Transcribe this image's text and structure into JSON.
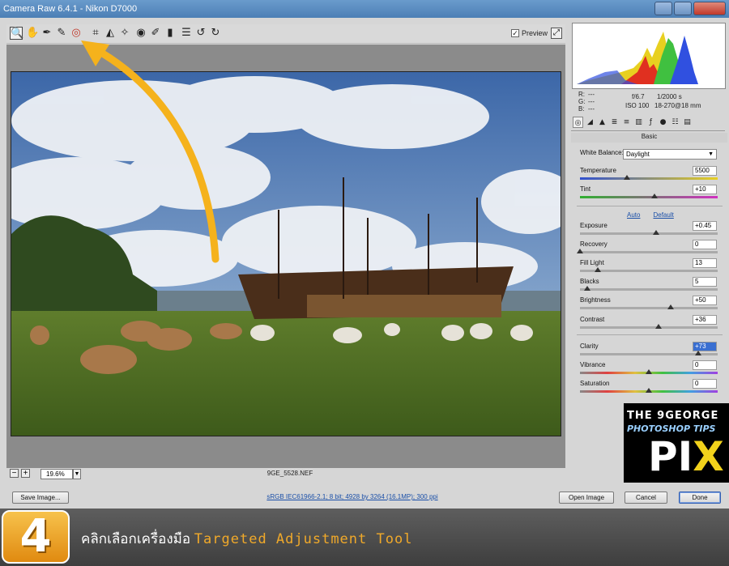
{
  "window": {
    "title": "Camera Raw 6.4.1  -  Nikon D7000"
  },
  "toolbar": {
    "tools": [
      {
        "name": "zoom-tool",
        "glyph": "🔍"
      },
      {
        "name": "hand-tool",
        "glyph": "✋"
      },
      {
        "name": "white-balance-tool",
        "glyph": "✒"
      },
      {
        "name": "color-sampler-tool",
        "glyph": "✎"
      },
      {
        "name": "targeted-adjustment-tool",
        "glyph": "◎"
      },
      {
        "name": "crop-tool",
        "glyph": "⌗"
      },
      {
        "name": "straighten-tool",
        "glyph": "◭"
      },
      {
        "name": "spot-removal-tool",
        "glyph": "✧"
      },
      {
        "name": "red-eye-tool",
        "glyph": "◉"
      },
      {
        "name": "adjustment-brush-tool",
        "glyph": "✐"
      },
      {
        "name": "graduated-filter-tool",
        "glyph": "▮"
      },
      {
        "name": "preferences-tool",
        "glyph": "☰"
      },
      {
        "name": "rotate-left-tool",
        "glyph": "↺"
      },
      {
        "name": "rotate-right-tool",
        "glyph": "↻"
      }
    ],
    "preview_label": "Preview",
    "preview_check": "✓"
  },
  "image_info": {
    "r_label": "R:",
    "g_label": "G:",
    "b_label": "B:",
    "r_value": "---",
    "g_value": "---",
    "b_value": "---",
    "aperture": "f/6.7",
    "shutter": "1/2000 s",
    "iso": "ISO 100",
    "lens": "18-270@18 mm"
  },
  "panel": {
    "title": "Basic",
    "white_balance_label": "White Balance:",
    "white_balance_value": "Daylight",
    "auto_label": "Auto",
    "default_label": "Default",
    "sliders": [
      {
        "label": "Temperature",
        "value": "5500",
        "pos": 0.34
      },
      {
        "label": "Tint",
        "value": "+10",
        "pos": 0.54
      },
      {
        "label": "Exposure",
        "value": "+0.45",
        "pos": 0.55
      },
      {
        "label": "Recovery",
        "value": "0",
        "pos": 0.0
      },
      {
        "label": "Fill Light",
        "value": "13",
        "pos": 0.13
      },
      {
        "label": "Blacks",
        "value": "5",
        "pos": 0.05
      },
      {
        "label": "Brightness",
        "value": "+50",
        "pos": 0.66
      },
      {
        "label": "Contrast",
        "value": "+36",
        "pos": 0.57
      },
      {
        "label": "Clarity",
        "value": "+73",
        "pos": 0.86
      },
      {
        "label": "Vibrance",
        "value": "0",
        "pos": 0.5
      },
      {
        "label": "Saturation",
        "value": "0",
        "pos": 0.5
      }
    ]
  },
  "status": {
    "zoom_value": "19.6%",
    "zoom_minus": "−",
    "zoom_plus": "+",
    "filename": "9GE_5528.NEF",
    "workflow_link": "sRGB IEC61966-2.1; 8 bit; 4928 by 3264 (16.1MP); 300 ppi"
  },
  "footer": {
    "save_image": "Save Image...",
    "open_image": "Open Image",
    "cancel": "Cancel",
    "done": "Done"
  },
  "banner": {
    "step_number": "4",
    "caption_thai": "คลิกเลือกเครื่องมือ",
    "caption_tool": "Targeted Adjustment Tool"
  },
  "logo": {
    "line1": "THE 9GEORGE",
    "line2": "PHOTOSHOP TIPS",
    "pix_a": "PI",
    "pix_b": "X"
  },
  "colors": {
    "accent_link": "#1a4fa8",
    "banner_highlight": "#f0a92a",
    "arrow": "#f5b21c"
  }
}
